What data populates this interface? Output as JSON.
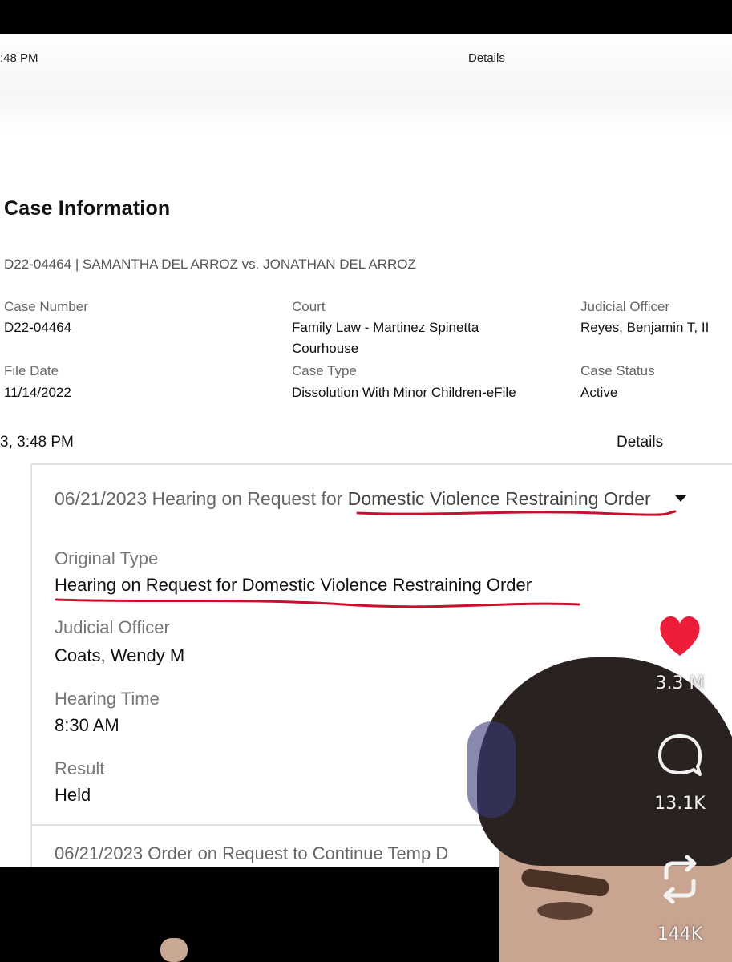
{
  "status_bar": {
    "time": ":48 PM",
    "title": "Details"
  },
  "case_information": {
    "heading": "Case Information",
    "title": "D22-04464 | SAMANTHA DEL ARROZ vs. JONATHAN DEL ARROZ",
    "fields": {
      "case_number_label": "Case Number",
      "case_number": "D22-04464",
      "court_label": "Court",
      "court_line1": "Family Law - Martinez Spinetta",
      "court_line2": "Courhouse",
      "judicial_officer_label": "Judicial Officer",
      "judicial_officer": "Reyes, Benjamin T, II",
      "file_date_label": "File Date",
      "file_date": "11/14/2022",
      "case_type_label": "Case Type",
      "case_type": "Dissolution With Minor Children-eFile",
      "case_status_label": "Case Status",
      "case_status": "Active"
    }
  },
  "second_status_bar": {
    "time": "3, 3:48 PM",
    "title": "Details"
  },
  "hearing": {
    "title_prefix": "06/21/2023 Hearing on Request for ",
    "title_highlight": "Domestic Violence Restraining Order",
    "original_type_label": "Original Type",
    "original_type": "Hearing on Request for Domestic Violence Restraining Order",
    "judicial_officer_label": "Judicial Officer",
    "judicial_officer": "Coats, Wendy M",
    "hearing_time_label": "Hearing Time",
    "hearing_time": "8:30 AM",
    "result_label": "Result",
    "result": "Held"
  },
  "next_hearing": {
    "title": "06/21/2023 Order on Request to Continue Temp D"
  },
  "actions": {
    "likes": "3.3 M",
    "comments": "13.1K",
    "shares": "144K"
  },
  "colors": {
    "like_red": "#ee1d3a",
    "underline_red": "#c8102e",
    "label_gray": "#666666"
  },
  "icons": [
    "heart-icon",
    "comment-icon",
    "repost-icon",
    "caret-down-icon"
  ]
}
